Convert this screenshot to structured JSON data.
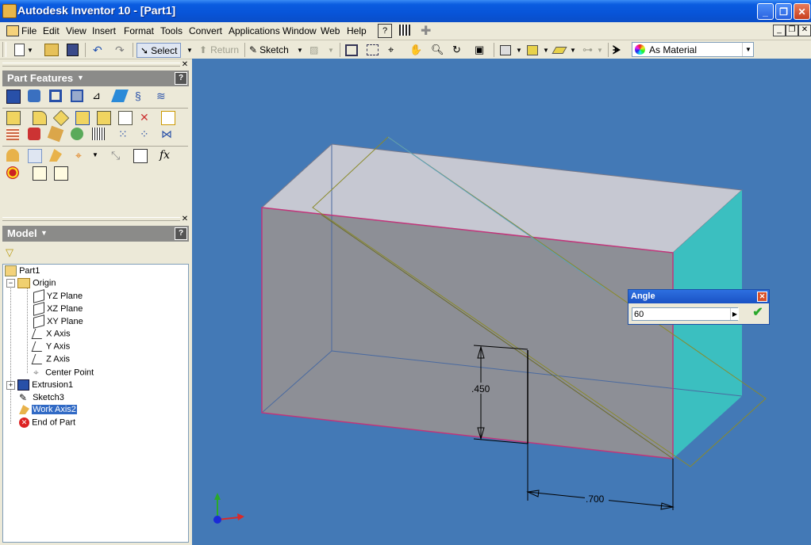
{
  "window": {
    "title": "Autodesk Inventor 10 - [Part1]"
  },
  "menu": [
    "File",
    "Edit",
    "View",
    "Insert",
    "Format",
    "Tools",
    "Convert",
    "Applications",
    "Window",
    "Web",
    "Help"
  ],
  "toolbar": {
    "select": "Select",
    "return": "Return",
    "sketch": "Sketch",
    "material": "As Material"
  },
  "part_features": {
    "title": "Part Features"
  },
  "model": {
    "title": "Model",
    "tree": {
      "part": "Part1",
      "origin": "Origin",
      "yz": "YZ Plane",
      "xz": "XZ Plane",
      "xy": "XY Plane",
      "xaxis": "X Axis",
      "yaxis": "Y Axis",
      "zaxis": "Z Axis",
      "center": "Center Point",
      "extrusion": "Extrusion1",
      "sketch": "Sketch3",
      "workaxis": "Work Axis2",
      "end": "End of Part"
    }
  },
  "dimensions": {
    "d1": ".450",
    "d2": ".700"
  },
  "angle_dialog": {
    "title": "Angle",
    "value": "60"
  },
  "colors": {
    "viewport": "#4379b6",
    "accent": "#0a5ce0",
    "box_edge": "#c2357a",
    "side_face": "#3bbfc0"
  }
}
